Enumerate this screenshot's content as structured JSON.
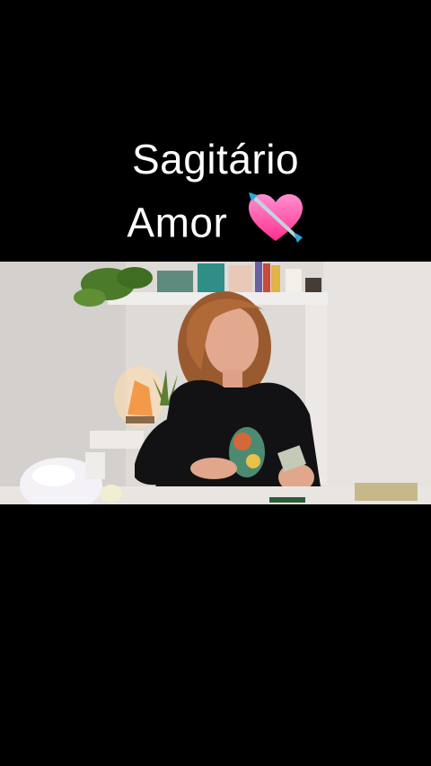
{
  "caption": {
    "line1": "Sagitário",
    "line2": "Amor",
    "emoji_icon": "heart-with-arrow-icon"
  },
  "colors": {
    "background": "#000000",
    "caption_text": "#ffffff",
    "heart": "#ff4fa8"
  }
}
